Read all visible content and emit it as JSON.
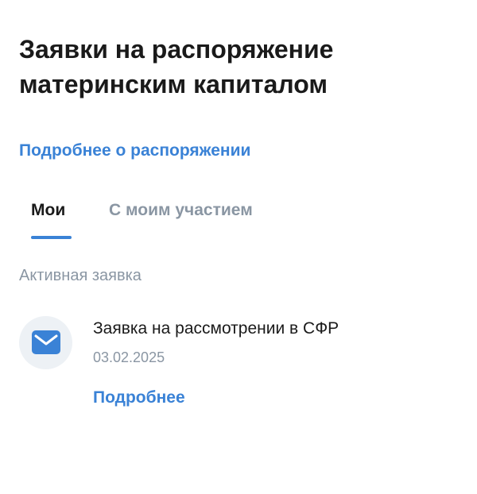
{
  "header": {
    "title": "Заявки на распоряжение материнским капиталом",
    "more_link": "Подробнее о распоряжении"
  },
  "tabs": [
    {
      "label": "Мои",
      "active": true
    },
    {
      "label": "С моим участием",
      "active": false
    }
  ],
  "section": {
    "label": "Активная заявка"
  },
  "application": {
    "icon": "envelope-icon",
    "status_title": "Заявка на рассмотрении в СФР",
    "date": "03.02.2025",
    "details_link": "Подробнее"
  },
  "colors": {
    "accent": "#3a82d6",
    "muted": "#8a96a3",
    "text": "#1a1a1a",
    "icon_bg": "#edf1f5"
  }
}
